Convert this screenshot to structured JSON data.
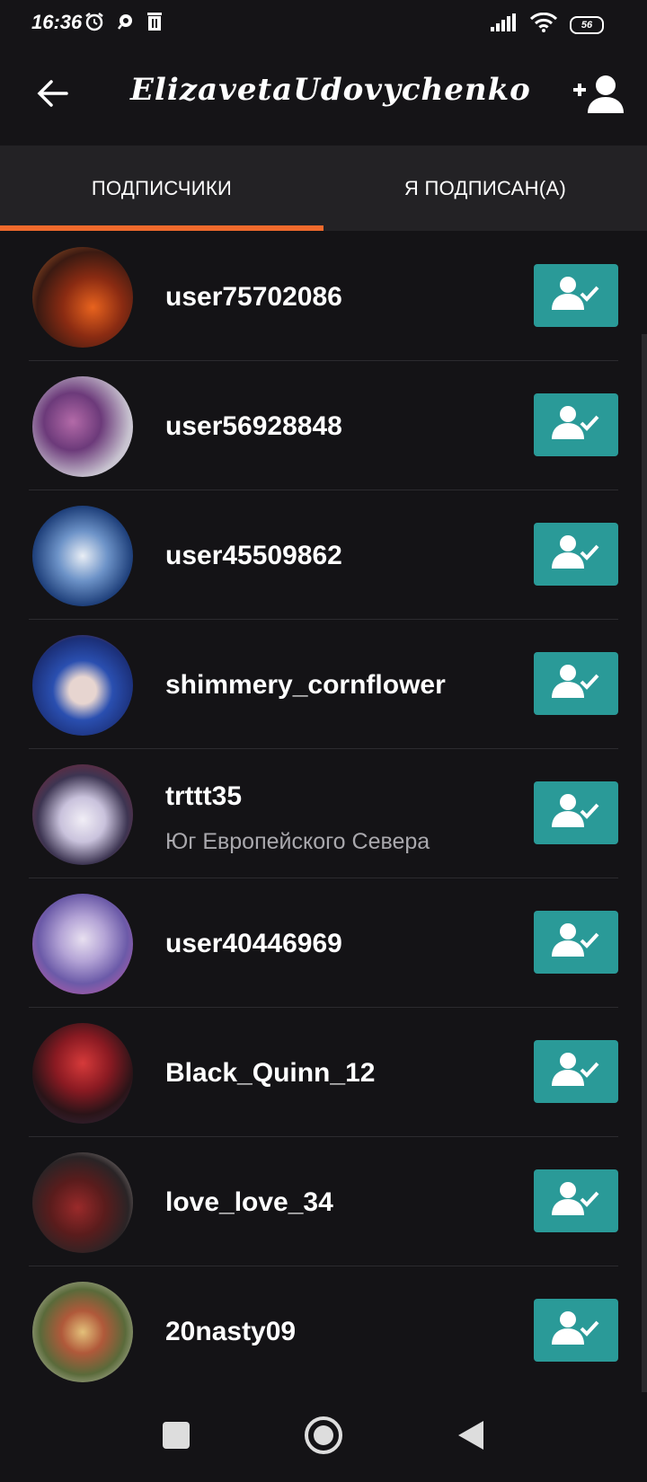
{
  "status_bar": {
    "time": "16:36",
    "battery": "56",
    "icons_left": [
      "alarm-icon",
      "chat-icon",
      "trash-icon"
    ],
    "icons_right": [
      "signal-icon",
      "wifi-icon",
      "battery-icon"
    ]
  },
  "header": {
    "title": "ElizavetaUdovychenko",
    "back_icon": "arrow-left-icon",
    "add_user_icon": "add-user-icon"
  },
  "tabs": [
    {
      "label": "ПОДПИСЧИКИ",
      "active": true
    },
    {
      "label": "Я ПОДПИСАН(А)",
      "active": false
    }
  ],
  "accent_color": "#f06a2c",
  "button_color": "#2a9a98",
  "followers": [
    {
      "username": "user75702086",
      "subtitle": ""
    },
    {
      "username": "user56928848",
      "subtitle": ""
    },
    {
      "username": "user45509862",
      "subtitle": ""
    },
    {
      "username": "shimmery_cornflower",
      "subtitle": ""
    },
    {
      "username": "trttt35",
      "subtitle": "Юг Европейского Севера"
    },
    {
      "username": "user40446969",
      "subtitle": ""
    },
    {
      "username": "Black_Quinn_12",
      "subtitle": ""
    },
    {
      "username": "love_love_34",
      "subtitle": ""
    },
    {
      "username": "20nasty09",
      "subtitle": ""
    }
  ],
  "nav_bar": {
    "icons": [
      "recent-apps-icon",
      "home-icon",
      "back-icon"
    ]
  }
}
